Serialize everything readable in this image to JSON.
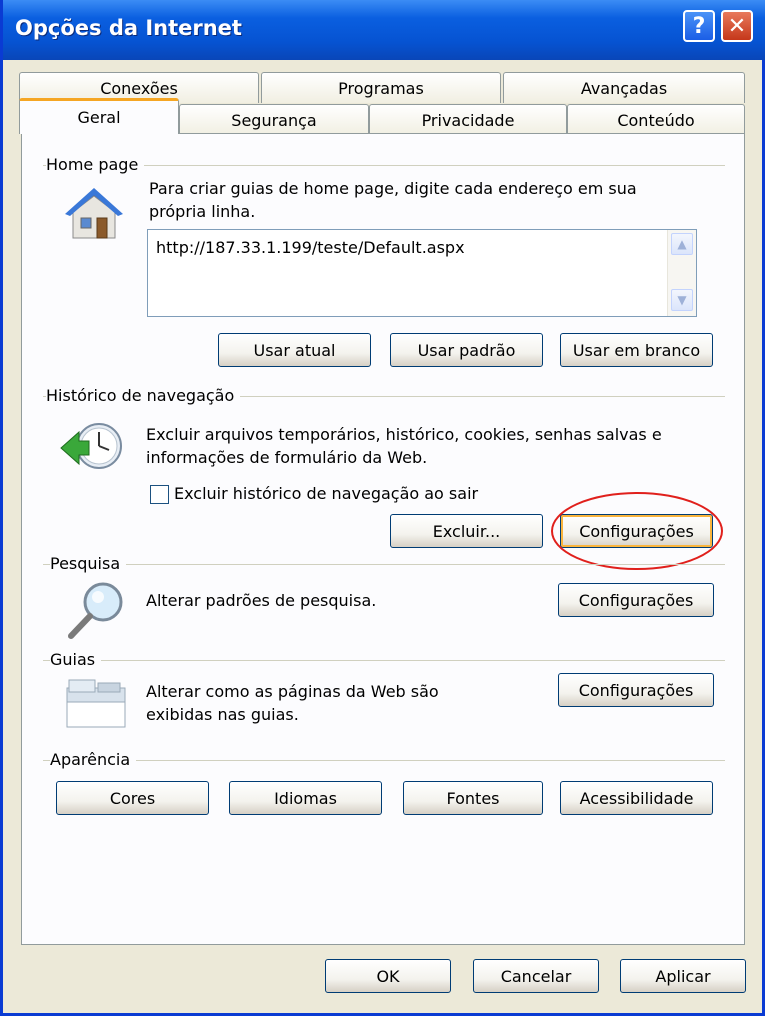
{
  "window": {
    "title": "Opções da Internet",
    "help_glyph": "?",
    "close_glyph": "✕"
  },
  "tabs": {
    "row_back": [
      "Conexões",
      "Programas",
      "Avançadas"
    ],
    "row_front": [
      "Geral",
      "Segurança",
      "Privacidade",
      "Conteúdo"
    ],
    "active": "Geral"
  },
  "home_page": {
    "header": "Home page",
    "description_line1": "Para criar guias de home page, digite cada endereço em sua",
    "description_line2": "própria linha.",
    "url_value": "http://187.33.1.199/teste/Default.aspx",
    "buttons": {
      "use_current": "Usar atual",
      "use_default": "Usar padrão",
      "use_blank": "Usar em branco"
    }
  },
  "history": {
    "header": "Histórico de navegação",
    "description_line1": "Excluir arquivos temporários, histórico, cookies, senhas salvas e",
    "description_line2": "informações de formulário da Web.",
    "checkbox_label": "Excluir histórico de navegação ao sair",
    "checkbox_checked": false,
    "buttons": {
      "delete": "Excluir...",
      "settings": "Configurações"
    },
    "highlight_color": "#e0201c"
  },
  "search": {
    "header": "Pesquisa",
    "description": "Alterar padrões de pesquisa.",
    "settings_button": "Configurações"
  },
  "tabs_section": {
    "header": "Guias",
    "description_line1": "Alterar como as páginas da Web são",
    "description_line2": "exibidas nas guias.",
    "settings_button": "Configurações"
  },
  "appearance": {
    "header": "Aparência",
    "buttons": {
      "colors": "Cores",
      "languages": "Idiomas",
      "fonts": "Fontes",
      "accessibility": "Acessibilidade"
    }
  },
  "footer": {
    "ok": "OK",
    "cancel": "Cancelar",
    "apply": "Aplicar"
  },
  "colors": {
    "titlebar": "#0653d2",
    "dialog_bg": "#ece9d8",
    "active_tab_accent": "#f5a623"
  }
}
